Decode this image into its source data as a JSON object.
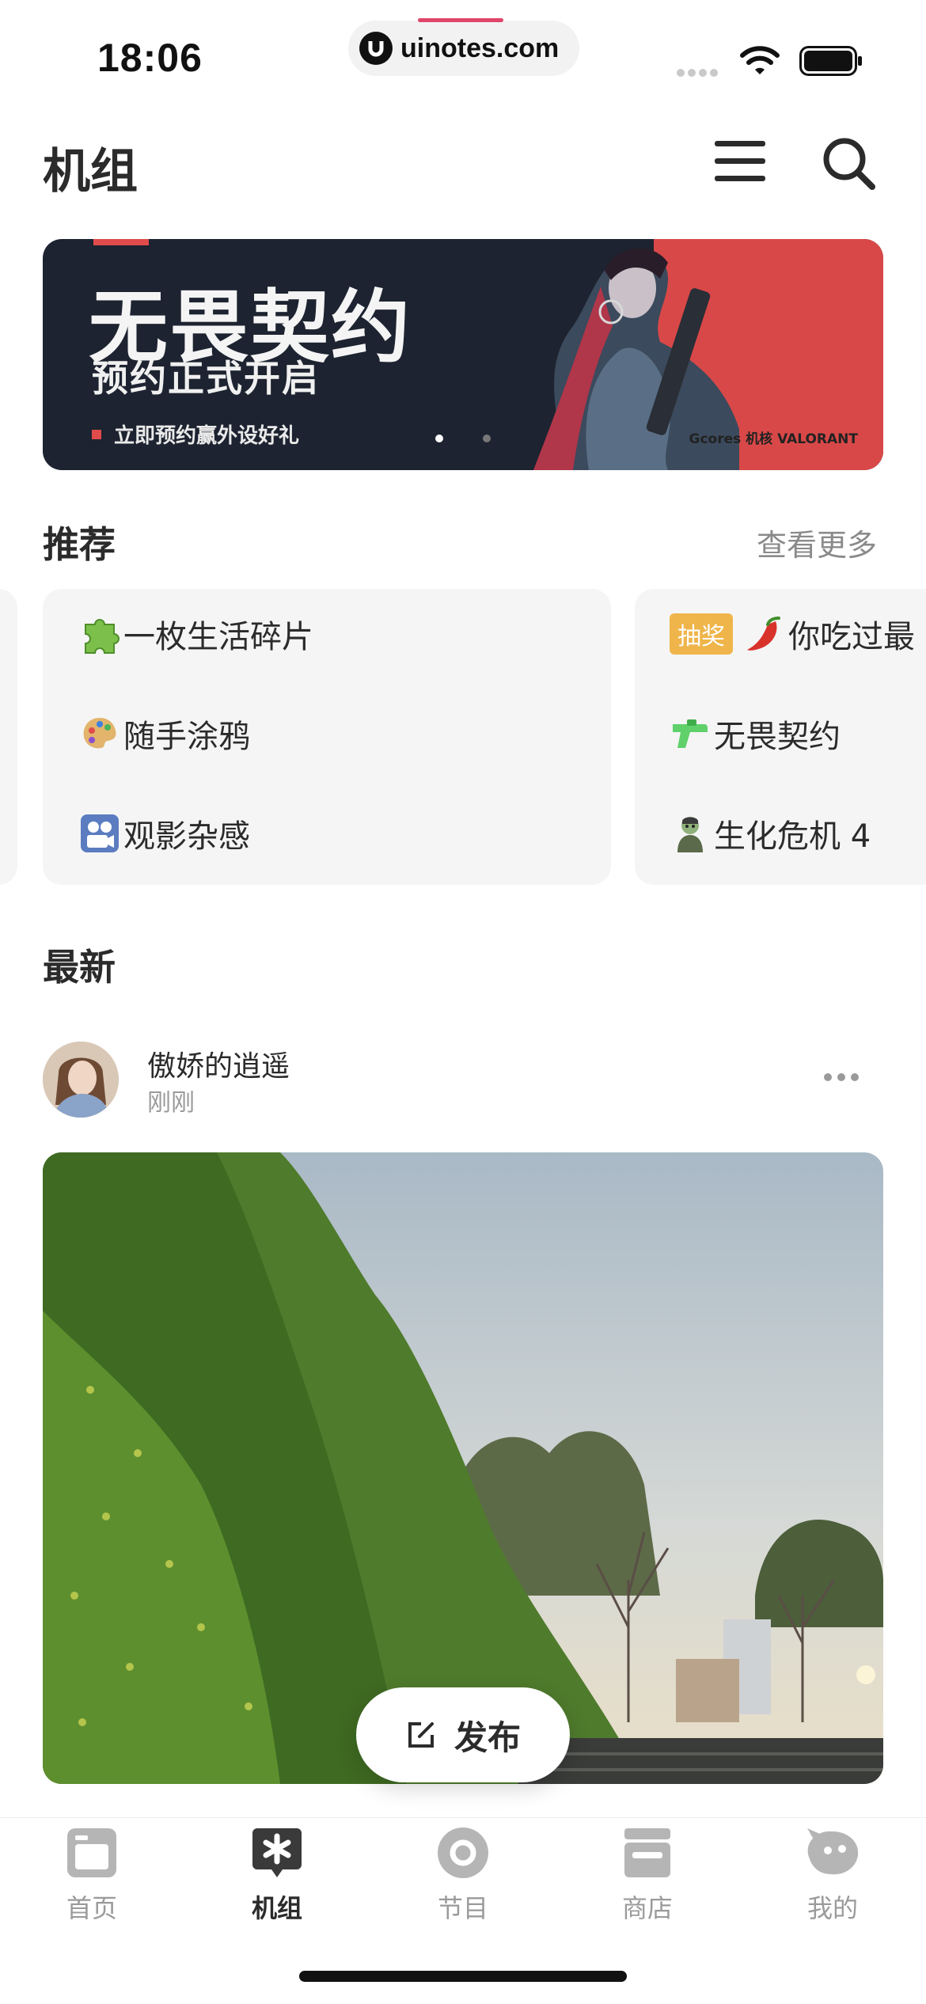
{
  "status_bar": {
    "time": "18:06",
    "url": "uinotes.com"
  },
  "header": {
    "title": "机组",
    "menu_icon": "menu-icon",
    "search_icon": "search-icon"
  },
  "banner": {
    "title": "无畏契约",
    "subtitle": "预约正式开启",
    "cta": "立即预约赢外设好礼",
    "logos": "Gcores 机核   VALORANT",
    "page_count": 2,
    "active_page": 1
  },
  "recommend": {
    "title": "推荐",
    "more": "查看更多",
    "cards": [
      {
        "items": [
          {
            "icon": "puzzle-icon",
            "label": "一枚生活碎片"
          },
          {
            "icon": "palette-icon",
            "label": "随手涂鸦"
          },
          {
            "icon": "film-camera-icon",
            "label": "观影杂感"
          }
        ]
      },
      {
        "items": [
          {
            "tag": "抽奖",
            "icon": "chili-icon",
            "label": "你吃过最"
          },
          {
            "icon": "water-gun-icon",
            "label": "无畏契约"
          },
          {
            "icon": "zombie-icon",
            "label": "生化危机 4"
          }
        ]
      }
    ]
  },
  "latest": {
    "title": "最新",
    "post": {
      "author": "傲娇的逍遥",
      "time": "刚刚"
    }
  },
  "publish_button": {
    "label": "发布"
  },
  "tabbar": {
    "tabs": [
      {
        "label": "首页",
        "icon": "home-icon",
        "active": false
      },
      {
        "label": "机组",
        "icon": "asterisk-chat-icon",
        "active": true
      },
      {
        "label": "节目",
        "icon": "radio-icon",
        "active": false
      },
      {
        "label": "商店",
        "icon": "store-icon",
        "active": false
      },
      {
        "label": "我的",
        "icon": "profile-icon",
        "active": false
      }
    ]
  },
  "colors": {
    "accent_red": "#e04b4b",
    "tag_yellow": "#efb54a",
    "text_dark": "#2b2b2b",
    "text_muted": "#9a9a9a",
    "card_bg": "#f5f5f5"
  }
}
